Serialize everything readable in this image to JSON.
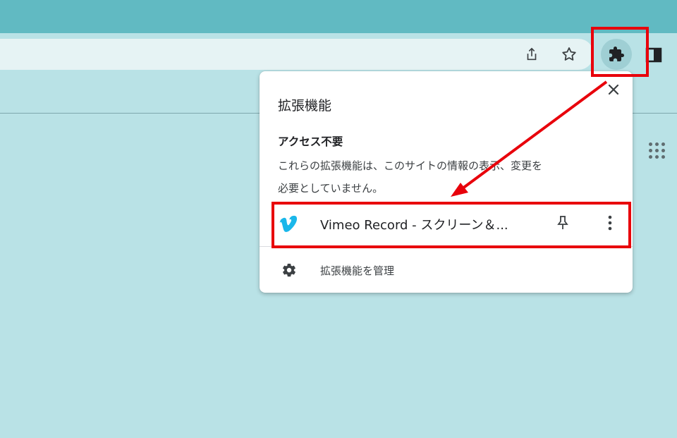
{
  "browser": {
    "toolbar_icons": [
      "share-icon",
      "bookmark-star-icon",
      "extensions-puzzle-icon",
      "side-panel-icon"
    ]
  },
  "popup": {
    "title": "拡張機能",
    "close_icon": "close-icon",
    "section_heading": "アクセス不要",
    "section_description_line1": "これらの拡張機能は、このサイトの情報の表示、変更を",
    "section_description_line2": "必要としていません。",
    "extensions": [
      {
        "name": "Vimeo Record - スクリーン＆...",
        "icon": "vimeo-icon",
        "icon_color": "#1ab7ea"
      }
    ],
    "manage_label": "拡張機能を管理"
  },
  "colors": {
    "tabstrip": "#61bac2",
    "toolbar": "#b9e2e6",
    "highlight": "#e8000b"
  }
}
